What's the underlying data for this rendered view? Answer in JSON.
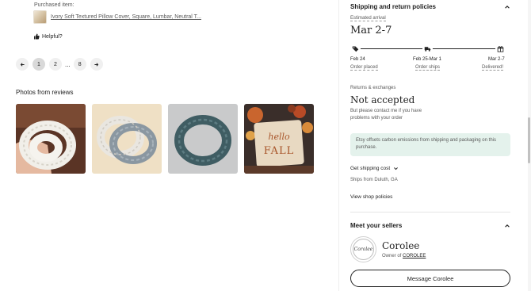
{
  "review": {
    "purchased_label": "Purchased item:",
    "purchased_item": "Ivory Soft Textured Pillow Cover, Square, Lumbar, Neutral T...",
    "helpful_label": "Helpful?"
  },
  "pagination": {
    "pages": [
      "1",
      "2",
      "8"
    ],
    "ellipsis": "...",
    "current": "1"
  },
  "photos": {
    "title": "Photos from reviews",
    "items": [
      {
        "name": "review-photo-white-scrunchie",
        "alt": "White scrunchie"
      },
      {
        "name": "review-photo-grey-scrunchies",
        "alt": "Grey and white scrunchies"
      },
      {
        "name": "review-photo-blue-scrunchie",
        "alt": "Blue scrunchie"
      },
      {
        "name": "review-photo-fall-pillow",
        "alt": "Hello Fall pillow"
      }
    ],
    "pillow_text_line1": "hello",
    "pillow_text_line2": "FALL"
  },
  "shipping": {
    "title": "Shipping and return policies",
    "estimated_label": "Estimated arrival",
    "estimated_date": "Mar 2-7",
    "timeline": [
      {
        "date": "Feb 24",
        "label": "Order placed",
        "icon": "tag-icon"
      },
      {
        "date": "Feb 25-Mar 1",
        "label": "Order ships",
        "icon": "truck-icon"
      },
      {
        "date": "Mar 2-7",
        "label": "Delivered!",
        "icon": "gift-icon"
      }
    ],
    "returns_label": "Returns & exchanges",
    "returns_value": "Not accepted",
    "returns_note": "But please contact me if you have problems with your order",
    "carbon_note": "Etsy offsets carbon emissions from shipping and packaging on this purchase.",
    "get_cost": "Get shipping cost",
    "ships_from": "Ships from Duluth, GA",
    "view_policies": "View shop policies"
  },
  "seller": {
    "title": "Meet your sellers",
    "logo_text": "Corolee",
    "name": "Corolee",
    "owner_prefix": "Owner of ",
    "shop": "COROLEE",
    "message_button": "Message Corolee"
  }
}
